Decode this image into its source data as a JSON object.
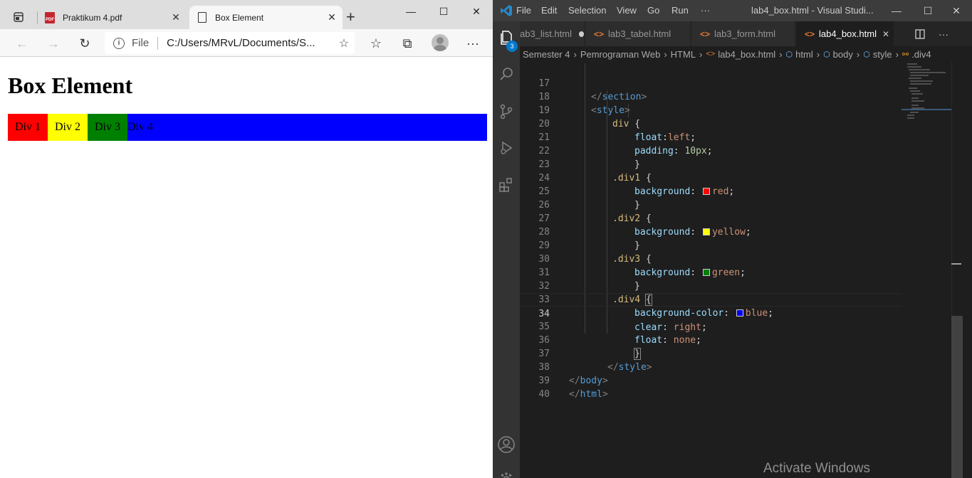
{
  "browser": {
    "tabs": [
      {
        "title": "Praktikum 4.pdf",
        "close": "✕"
      },
      {
        "title": "Box Element",
        "close": "✕"
      }
    ],
    "new_tab": "+",
    "window_controls": {
      "minimize": "—",
      "maximize": "☐",
      "close": "✕"
    },
    "nav": {
      "back": "←",
      "forward": "→",
      "refresh": "↻",
      "favorites": "☆",
      "collections": "⧉",
      "more": "···"
    },
    "address": {
      "scheme": "File",
      "url": "C:/Users/MRvL/Documents/S...",
      "star": "☆"
    },
    "page": {
      "heading": "Box Element",
      "boxes": [
        {
          "label": "Div 1",
          "color": "#ff0000"
        },
        {
          "label": "Div 2",
          "color": "#ffff00"
        },
        {
          "label": "Div 3",
          "color": "#008000"
        },
        {
          "label": "Div 4",
          "color": "#0000ff"
        }
      ]
    }
  },
  "vscode": {
    "menu": [
      "File",
      "Edit",
      "Selection",
      "View",
      "Go",
      "Run",
      "···"
    ],
    "window_title": "lab4_box.html - Visual Studi...",
    "window_controls": {
      "minimize": "—",
      "maximize": "☐",
      "close": "✕"
    },
    "explorer_badge": "3",
    "tabs": [
      {
        "label": "ab3_list.html",
        "modified": true
      },
      {
        "label": "lab3_tabel.html"
      },
      {
        "label": "lab3_form.html"
      },
      {
        "label": "lab4_box.html",
        "active": true
      }
    ],
    "breadcrumbs": [
      "Semester 4",
      "Pemrograman Web",
      "HTML",
      "lab4_box.html",
      "html",
      "body",
      "style",
      ".div4"
    ],
    "current_line": 34,
    "line_numbers": [
      "17",
      "18",
      "19",
      "20",
      "21",
      "22",
      "23",
      "24",
      "25",
      "26",
      "27",
      "28",
      "29",
      "30",
      "31",
      "32",
      "33",
      "34",
      "35",
      "36",
      "37",
      "38",
      "39",
      "40"
    ],
    "code": {
      "l17": {
        "open": "</",
        "tag": "section",
        "close": ">"
      },
      "l18": {
        "open": "<",
        "tag": "style",
        "close": ">"
      },
      "l19": {
        "sel": "div",
        "brace": " {"
      },
      "l20": {
        "prop": "float",
        "colon": ":",
        "val": "left",
        "semi": ";"
      },
      "l21": {
        "prop": "padding",
        "colon": ": ",
        "num": "10px",
        "semi": ";"
      },
      "l22": {
        "brace": "}"
      },
      "l23": {
        "sel": ".div1",
        "brace": " {"
      },
      "l24": {
        "prop": "background",
        "colon": ": ",
        "val": "red",
        "semi": ";",
        "swatch": "#ff0000"
      },
      "l25": {
        "brace": "}"
      },
      "l26": {
        "sel": ".div2",
        "brace": " {"
      },
      "l27": {
        "prop": "background",
        "colon": ": ",
        "val": "yellow",
        "semi": ";",
        "swatch": "#ffff00"
      },
      "l28": {
        "brace": "}"
      },
      "l29": {
        "sel": ".div3",
        "brace": " {"
      },
      "l30": {
        "prop": "background",
        "colon": ": ",
        "val": "green",
        "semi": ";",
        "swatch": "#008000"
      },
      "l31": {
        "brace": "}"
      },
      "l32": {
        "sel": ".div4",
        "brace": "{"
      },
      "l33": {
        "prop": "background-color",
        "colon": ": ",
        "val": "blue",
        "semi": ";",
        "swatch": "#0000ff"
      },
      "l34": {
        "prop": "clear",
        "colon": ": ",
        "val": "right",
        "semi": ";"
      },
      "l35": {
        "prop": "float",
        "colon": ": ",
        "val": "none",
        "semi": ";"
      },
      "l36": {
        "brace": "}"
      },
      "l37": {
        "open": "</",
        "tag": "style",
        "close": ">"
      },
      "l38": {
        "open": "</",
        "tag": "body",
        "close": ">"
      },
      "l39": {
        "open": "</",
        "tag": "html",
        "close": ">"
      }
    },
    "watermark": "Activate Windows"
  },
  "colors": {
    "vscode_accent": "#007acc",
    "html_icon": "#e37933",
    "tag": "#569cd6",
    "selector": "#d7ba7d",
    "property": "#9cdcfe",
    "value": "#ce9178",
    "number": "#b5cea8"
  },
  "icons": [
    "tab-actions-icon",
    "pdf-file-icon",
    "page-icon",
    "info-icon",
    "profile-avatar",
    "vscode-logo-icon",
    "explorer-icon",
    "search-icon",
    "source-control-icon",
    "run-debug-icon",
    "extensions-icon",
    "accounts-icon",
    "manage-gear-icon",
    "split-editor-icon"
  ]
}
